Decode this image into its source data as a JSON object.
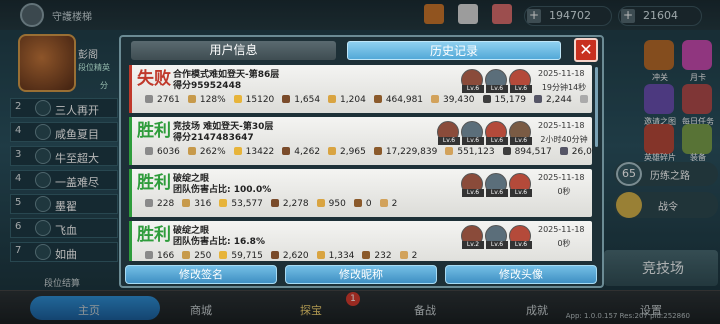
{
  "top": {
    "title": "守護楼梯",
    "diamonds": "194702",
    "coins": "21604"
  },
  "left": {
    "header_name": "彭阁",
    "header_sub": "段位精英",
    "header_side": "分",
    "items": [
      {
        "num": "2",
        "label": "三人再开"
      },
      {
        "num": "4",
        "label": "咸鱼夏目"
      },
      {
        "num": "3",
        "label": "牛至超大"
      },
      {
        "num": "4",
        "label": "一盖难尽"
      },
      {
        "num": "5",
        "label": "墨翟"
      },
      {
        "num": "6",
        "label": "飞血"
      },
      {
        "num": "7",
        "label": "如曲"
      }
    ],
    "footer": "段位结算"
  },
  "right": {
    "icons": [
      "冲关",
      "月卡",
      "邀请之图",
      "每日任务",
      "英雄碎片",
      "装备"
    ],
    "level": "65",
    "level_label": "历练之路",
    "stage_label": "战令",
    "arena": "竞技场"
  },
  "bottom": {
    "nav": [
      "主页",
      "商城",
      "探宝",
      "备战",
      "成就",
      "设置"
    ],
    "badge": "1",
    "version": "App: 1.0.0.157 Res:207 pid:252860"
  },
  "modal": {
    "tab_info": "用户信息",
    "tab_history": "历史记录",
    "close": "✕",
    "records": [
      {
        "result": "失败",
        "result_color": "#c0392b",
        "bar_color": "#c0392b",
        "name": "合作模式难如登天-第86层",
        "score": "得分95952448",
        "stats": [
          "2761",
          "128%",
          "15120",
          "1,654",
          "1,204",
          "464,981",
          "39,430",
          "15,179",
          "2,244",
          "15"
        ],
        "date": "2025-11-18",
        "duration": "19分钟14秒",
        "heroes": [
          "Lv.6",
          "Lv.6",
          "Lv.6"
        ]
      },
      {
        "result": "胜利",
        "result_color": "#2e9c3b",
        "bar_color": "#2e9c3b",
        "name": "竞技场 难如登天-第30层",
        "score": "得分2147483647",
        "stats": [
          "6036",
          "262%",
          "13422",
          "4,262",
          "2,965",
          "17,229,839",
          "551,123",
          "894,517",
          "26,093",
          "246"
        ],
        "date": "2025-11-18",
        "duration": "2小时40分钟",
        "heroes": [
          "Lv.6",
          "Lv.6",
          "Lv.6",
          "Lv.6"
        ]
      },
      {
        "result": "胜利",
        "result_color": "#2e9c3b",
        "bar_color": "#2e9c3b",
        "name": "破绽之眼",
        "score": "团队伤害占比: 100.0%",
        "stats": [
          "228",
          "316",
          "53,577",
          "2,278",
          "950",
          "0",
          "2"
        ],
        "date": "2025-11-18",
        "duration": "0秒",
        "heroes": [
          "Lv.6",
          "Lv.6",
          "Lv.6"
        ]
      },
      {
        "result": "胜利",
        "result_color": "#2e9c3b",
        "bar_color": "#2e9c3b",
        "name": "破绽之眼",
        "score": "团队伤害占比: 16.8%",
        "stats": [
          "166",
          "250",
          "59,715",
          "2,620",
          "1,334",
          "232",
          "2"
        ],
        "date": "2025-11-18",
        "duration": "0秒",
        "heroes": [
          "Lv.2",
          "Lv.6",
          "Lv.6"
        ]
      }
    ],
    "buttons": [
      "修改签名",
      "修改昵称",
      "修改头像"
    ]
  }
}
